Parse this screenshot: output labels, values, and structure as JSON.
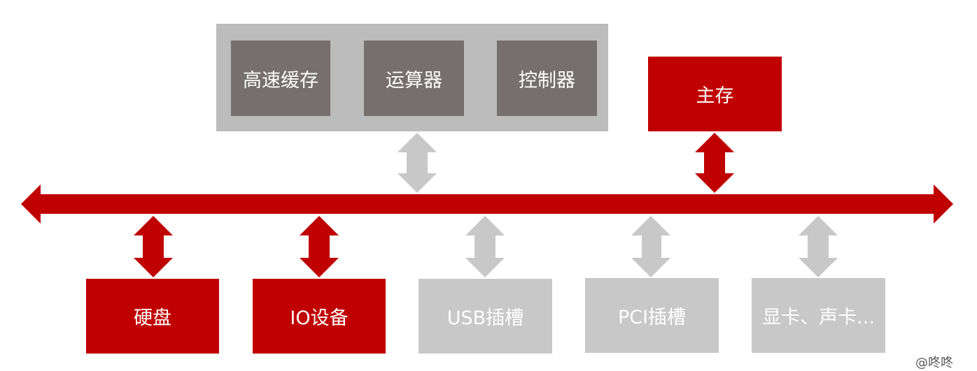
{
  "cpu": {
    "cache": "高速缓存",
    "alu": "运算器",
    "control": "控制器"
  },
  "main_memory": "主存",
  "devices": {
    "disk": "硬盘",
    "io": "IO设备",
    "usb": "USB插槽",
    "pci": "PCI插槽",
    "cards": "显卡、声卡..."
  },
  "footer": "@咚咚",
  "colors": {
    "bus_red": "#c00000",
    "grey_arrow": "#c8c8c8",
    "cpu_frame": "#bcbcbc",
    "cpu_inner": "#756f6e"
  }
}
